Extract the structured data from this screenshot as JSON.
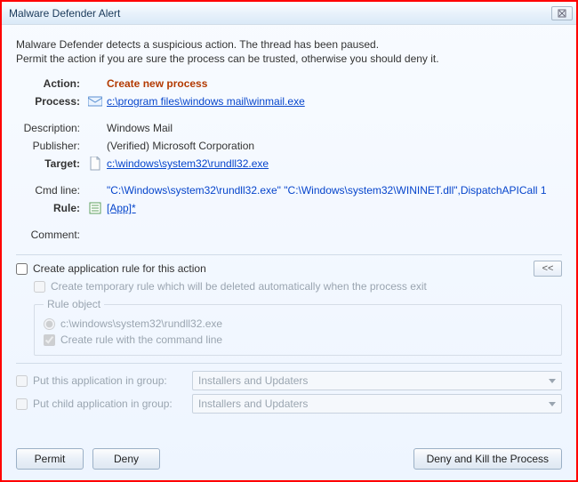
{
  "window": {
    "title": "Malware Defender Alert"
  },
  "intro": {
    "line1": "Malware Defender detects a suspicious action. The thread has been paused.",
    "line2": "Permit the action if you are sure the process can be trusted, otherwise you should deny it."
  },
  "details": {
    "action_label": "Action:",
    "action_value": "Create new process",
    "process_label": "Process:",
    "process_value": "c:\\program files\\windows mail\\winmail.exe",
    "description_label": "Description:",
    "description_value": "Windows Mail",
    "publisher_label": "Publisher:",
    "publisher_value": "(Verified) Microsoft Corporation",
    "target_label": "Target:",
    "target_value": "c:\\windows\\system32\\rundll32.exe",
    "cmdline_label": "Cmd line:",
    "cmdline_value": "\"C:\\Windows\\system32\\rundll32.exe\" \"C:\\Windows\\system32\\WININET.dll\",DispatchAPICall 1",
    "rule_label": "Rule:",
    "rule_value": "[App]*",
    "comment_label": "Comment:",
    "comment_value": ""
  },
  "rule": {
    "create_label": "Create application rule for this action",
    "expand_label": "<<",
    "temp_label": "Create temporary rule which will be deleted automatically when the process exit",
    "object_legend": "Rule object",
    "object_path": "c:\\windows\\system32\\rundll32.exe",
    "with_cmd_label": "Create rule with the command line"
  },
  "groups": {
    "put_app_label": "Put this application in group:",
    "put_child_label": "Put child application in group:",
    "selected": "Installers and Updaters"
  },
  "buttons": {
    "permit": "Permit",
    "deny": "Deny",
    "deny_kill": "Deny and Kill the Process"
  }
}
